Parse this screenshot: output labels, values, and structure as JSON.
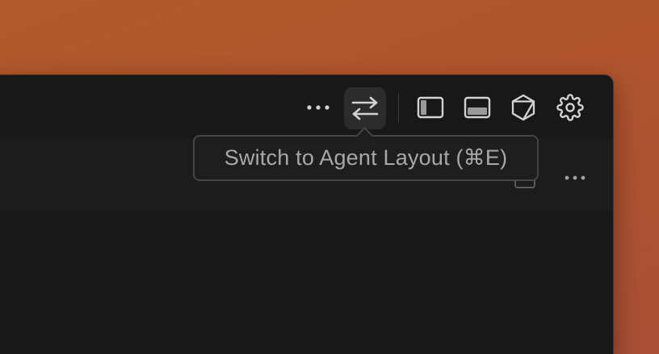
{
  "titlebar": {
    "more_icon": "ellipsis-icon",
    "layout_toggle_icon": "swap-arrows-icon",
    "sidebar_icon": "left-sidebar-toggle-icon",
    "panel_icon": "bottom-panel-toggle-icon",
    "agent_icon": "cube-icon",
    "settings_icon": "gear-icon"
  },
  "tooltip": {
    "text": "Switch to Agent Layout (⌘E)"
  },
  "editor": {
    "more_icon": "ellipsis-icon"
  },
  "colors": {
    "background": "#b0552e",
    "window": "#171717",
    "icon": "#d2d2d2",
    "tooltip_text": "#a8a8a8"
  }
}
